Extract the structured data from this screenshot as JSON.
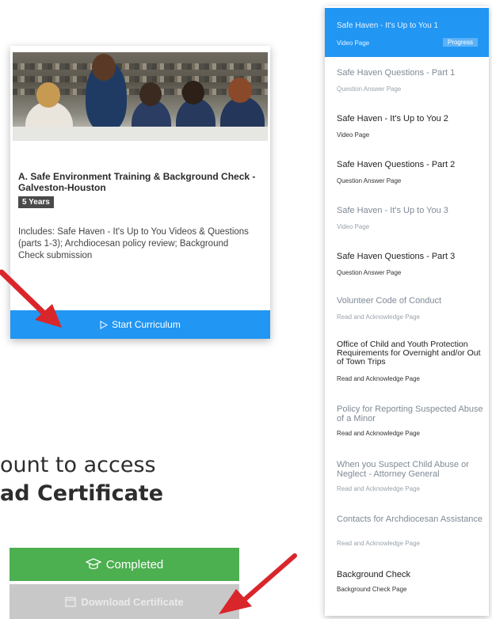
{
  "card": {
    "title": "A. Safe Environment Training & Background Check - Galveston-Houston",
    "badge": "5 Years",
    "description": "Includes: Safe Haven - It's Up to You Videos & Questions (parts 1-3); Archdiocesan policy review; Background Check submission",
    "start_button": "Start Curriculum",
    "start_icon": "play-outline-icon"
  },
  "partial_text": {
    "line1": "ount to access",
    "line2": "ad Certificate"
  },
  "status_buttons": {
    "completed": "Completed",
    "completed_icon": "graduation-cap-icon",
    "download": "Download Certificate",
    "download_icon": "calendar-icon"
  },
  "curriculum": {
    "items": [
      {
        "title": "Safe Haven - It's Up to You 1",
        "type": "Video Page",
        "state": "active",
        "tag": "Progress"
      },
      {
        "title": "Safe Haven Questions - Part 1",
        "type": "Question Answer Page",
        "state": "muted"
      },
      {
        "title": "Safe Haven - It's Up to You 2",
        "type": "Video Page",
        "state": "dark"
      },
      {
        "title": "Safe Haven Questions - Part 2",
        "type": "Question Answer Page",
        "state": "dark"
      },
      {
        "title": "Safe Haven - It's Up to You 3",
        "type": "Video Page",
        "state": "muted"
      },
      {
        "title": "Safe Haven Questions - Part 3",
        "type": "Question Answer Page",
        "state": "dark"
      },
      {
        "title": "Volunteer Code of Conduct",
        "type": "Read and Acknowledge Page",
        "state": "muted"
      },
      {
        "title": "Office of Child and Youth Protection Requirements for Overnight and/or Out of Town Trips",
        "type": "Read and Acknowledge Page",
        "state": "dark"
      },
      {
        "title": "Policy for Reporting Suspected Abuse of a Minor",
        "type": "Read and Acknowledge Page",
        "state": "muted"
      },
      {
        "title": "When you Suspect Child Abuse or Neglect - Attorney General",
        "type": "Read and Acknowledge Page",
        "state": "muted"
      },
      {
        "title": "Contacts for Archdiocesan Assistance",
        "type": "Read and Acknowledge Page",
        "state": "muted"
      },
      {
        "title": "Background Check",
        "type": "Background Check Page",
        "state": "dark"
      }
    ]
  },
  "colors": {
    "primary_blue": "#2196f3",
    "completed_green": "#4caf50",
    "disabled_gray": "#c8c8c8",
    "arrow_red": "#d9262b"
  }
}
